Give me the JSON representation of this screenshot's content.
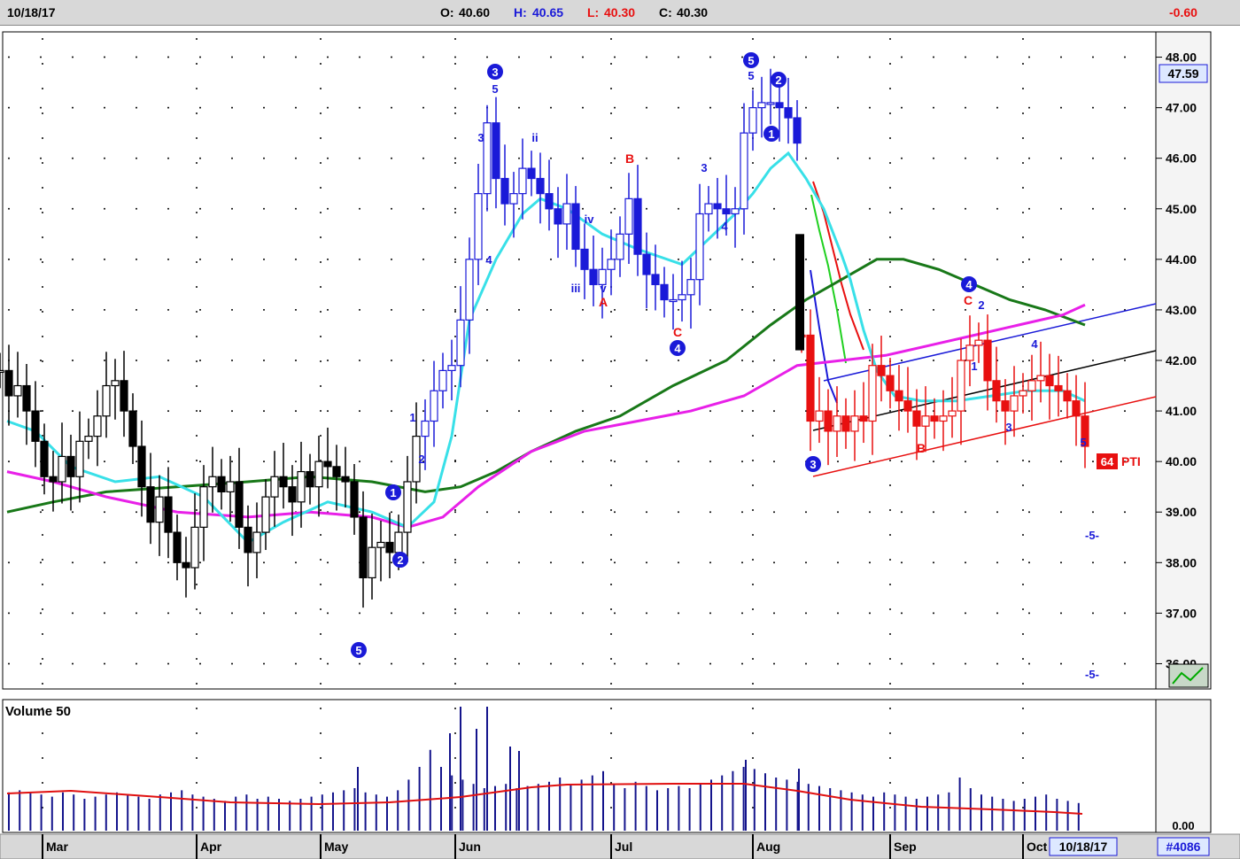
{
  "header": {
    "date": "10/18/17",
    "open_label": "O:",
    "open": "40.60",
    "high_label": "H:",
    "high": "40.65",
    "low_label": "L:",
    "low": "40.30",
    "close_label": "C:",
    "close": "40.30",
    "change": "-0.60"
  },
  "colors": {
    "bar_up_down": "#000000",
    "wave_blue": "#1a1ad8",
    "recent_red": "#e81010",
    "ema_cyan": "#38e0e8",
    "ma_magenta": "#e820e8",
    "ma_green": "#187818",
    "volume_bar": "#14148c",
    "volume_avg": "#e01010"
  },
  "price_panel": {
    "current_price": "47.59",
    "footer_badge": "#4086",
    "date_badge": "10/18/17",
    "pti_value": "64",
    "pti_label": "PTI",
    "target_markers": [
      "-5-",
      "-5-"
    ]
  },
  "volume_panel": {
    "title": "Volume 50",
    "axis_label": "0.00"
  },
  "chart_data": {
    "type": "candlestick",
    "y_axis": {
      "min": 35.5,
      "max": 48.5,
      "ticks": [
        "36.00",
        "37.00",
        "38.00",
        "39.00",
        "40.00",
        "41.00",
        "42.00",
        "43.00",
        "44.00",
        "45.00",
        "46.00",
        "47.00",
        "48.00"
      ]
    },
    "x_axis": {
      "months": [
        "Mar",
        "Apr",
        "May",
        "Jun",
        "Jul",
        "Aug",
        "Sep",
        "Oct"
      ]
    },
    "price_series": [
      [
        0,
        41.8
      ],
      [
        10,
        41.3
      ],
      [
        20,
        41.5
      ],
      [
        30,
        41.0
      ],
      [
        40,
        40.4
      ],
      [
        50,
        39.7
      ],
      [
        60,
        39.6
      ],
      [
        70,
        40.1
      ],
      [
        80,
        39.7
      ],
      [
        90,
        40.4
      ],
      [
        100,
        40.5
      ],
      [
        110,
        40.9
      ],
      [
        120,
        41.5
      ],
      [
        130,
        41.6
      ],
      [
        140,
        41.0
      ],
      [
        150,
        40.3
      ],
      [
        160,
        39.5
      ],
      [
        170,
        38.8
      ],
      [
        180,
        39.3
      ],
      [
        190,
        38.6
      ],
      [
        200,
        38.0
      ],
      [
        210,
        37.9
      ],
      [
        220,
        38.7
      ],
      [
        230,
        39.5
      ],
      [
        240,
        39.7
      ],
      [
        250,
        39.4
      ],
      [
        260,
        39.6
      ],
      [
        270,
        38.7
      ],
      [
        280,
        38.2
      ],
      [
        290,
        38.6
      ],
      [
        300,
        39.3
      ],
      [
        310,
        39.7
      ],
      [
        320,
        39.5
      ],
      [
        330,
        39.2
      ],
      [
        340,
        39.8
      ],
      [
        350,
        39.5
      ],
      [
        360,
        40.0
      ],
      [
        370,
        39.9
      ],
      [
        380,
        39.7
      ],
      [
        390,
        39.6
      ],
      [
        400,
        38.9
      ],
      [
        410,
        37.7
      ],
      [
        420,
        38.3
      ],
      [
        430,
        38.4
      ],
      [
        440,
        38.2
      ],
      [
        450,
        38.6
      ],
      [
        460,
        39.6
      ],
      [
        470,
        40.5
      ],
      [
        480,
        40.8
      ],
      [
        490,
        41.4
      ],
      [
        500,
        41.8
      ],
      [
        510,
        41.9
      ],
      [
        520,
        42.8
      ],
      [
        530,
        44.0
      ],
      [
        540,
        45.3
      ],
      [
        550,
        46.7
      ],
      [
        560,
        45.6
      ],
      [
        570,
        45.1
      ],
      [
        580,
        45.3
      ],
      [
        590,
        45.8
      ],
      [
        600,
        45.6
      ],
      [
        610,
        45.3
      ],
      [
        620,
        45.0
      ],
      [
        630,
        44.7
      ],
      [
        640,
        45.1
      ],
      [
        650,
        44.2
      ],
      [
        660,
        43.8
      ],
      [
        670,
        43.5
      ],
      [
        680,
        43.8
      ],
      [
        690,
        44.0
      ],
      [
        700,
        44.5
      ],
      [
        710,
        45.2
      ],
      [
        720,
        44.1
      ],
      [
        730,
        43.7
      ],
      [
        740,
        43.5
      ],
      [
        750,
        43.2
      ],
      [
        760,
        43.2
      ],
      [
        770,
        43.3
      ],
      [
        780,
        43.6
      ],
      [
        790,
        44.9
      ],
      [
        800,
        45.1
      ],
      [
        810,
        45.0
      ],
      [
        820,
        44.9
      ],
      [
        830,
        45.0
      ],
      [
        840,
        46.5
      ],
      [
        850,
        47.0
      ],
      [
        860,
        47.1
      ],
      [
        870,
        47.1
      ],
      [
        880,
        47.0
      ],
      [
        890,
        46.8
      ],
      [
        900,
        46.3
      ]
    ],
    "recent_series": [
      [
        905,
        42.5
      ],
      [
        915,
        40.8
      ],
      [
        925,
        41.0
      ],
      [
        935,
        40.6
      ],
      [
        945,
        40.9
      ],
      [
        955,
        40.6
      ],
      [
        965,
        40.9
      ],
      [
        975,
        40.8
      ],
      [
        985,
        41.9
      ],
      [
        995,
        41.7
      ],
      [
        1005,
        41.4
      ],
      [
        1015,
        41.2
      ],
      [
        1025,
        41.0
      ],
      [
        1035,
        40.7
      ],
      [
        1045,
        40.9
      ],
      [
        1055,
        40.8
      ],
      [
        1065,
        40.9
      ],
      [
        1075,
        41.0
      ],
      [
        1085,
        42.0
      ],
      [
        1095,
        42.3
      ],
      [
        1105,
        42.4
      ],
      [
        1115,
        41.6
      ],
      [
        1125,
        41.2
      ],
      [
        1135,
        41.0
      ],
      [
        1145,
        41.3
      ],
      [
        1155,
        41.4
      ],
      [
        1165,
        41.6
      ],
      [
        1175,
        41.7
      ],
      [
        1185,
        41.5
      ],
      [
        1195,
        41.4
      ],
      [
        1205,
        41.2
      ],
      [
        1215,
        40.9
      ],
      [
        1225,
        40.3
      ]
    ],
    "ema_fast": [
      [
        8,
        40.8
      ],
      [
        40,
        40.6
      ],
      [
        80,
        39.9
      ],
      [
        130,
        39.6
      ],
      [
        180,
        39.7
      ],
      [
        230,
        39.3
      ],
      [
        280,
        38.4
      ],
      [
        320,
        38.8
      ],
      [
        370,
        39.2
      ],
      [
        420,
        39.0
      ],
      [
        460,
        38.7
      ],
      [
        490,
        39.2
      ],
      [
        510,
        40.5
      ],
      [
        530,
        42.8
      ],
      [
        560,
        44.0
      ],
      [
        590,
        44.9
      ],
      [
        610,
        45.2
      ],
      [
        640,
        45.0
      ],
      [
        680,
        44.5
      ],
      [
        720,
        44.2
      ],
      [
        770,
        43.9
      ],
      [
        800,
        44.4
      ],
      [
        830,
        44.9
      ],
      [
        850,
        45.3
      ],
      [
        870,
        45.8
      ],
      [
        890,
        46.1
      ],
      [
        910,
        45.6
      ],
      [
        930,
        45.0
      ],
      [
        950,
        44.1
      ],
      [
        960,
        43.6
      ],
      [
        975,
        42.6
      ],
      [
        990,
        41.8
      ],
      [
        1010,
        41.3
      ],
      [
        1040,
        41.2
      ],
      [
        1080,
        41.2
      ],
      [
        1120,
        41.3
      ],
      [
        1160,
        41.4
      ],
      [
        1200,
        41.4
      ],
      [
        1225,
        41.2
      ]
    ],
    "ma_magenta": [
      [
        8,
        39.8
      ],
      [
        60,
        39.6
      ],
      [
        120,
        39.3
      ],
      [
        200,
        39.0
      ],
      [
        280,
        38.9
      ],
      [
        350,
        39.0
      ],
      [
        420,
        38.9
      ],
      [
        460,
        38.7
      ],
      [
        500,
        38.9
      ],
      [
        540,
        39.5
      ],
      [
        600,
        40.2
      ],
      [
        660,
        40.6
      ],
      [
        720,
        40.8
      ],
      [
        780,
        41.0
      ],
      [
        840,
        41.3
      ],
      [
        900,
        41.9
      ],
      [
        950,
        42.0
      ],
      [
        1000,
        42.1
      ],
      [
        1050,
        42.3
      ],
      [
        1100,
        42.5
      ],
      [
        1150,
        42.7
      ],
      [
        1200,
        42.9
      ],
      [
        1225,
        43.1
      ]
    ],
    "ma_green": [
      [
        8,
        39.0
      ],
      [
        60,
        39.2
      ],
      [
        120,
        39.4
      ],
      [
        200,
        39.5
      ],
      [
        280,
        39.6
      ],
      [
        350,
        39.7
      ],
      [
        420,
        39.6
      ],
      [
        480,
        39.4
      ],
      [
        520,
        39.5
      ],
      [
        560,
        39.8
      ],
      [
        600,
        40.2
      ],
      [
        650,
        40.6
      ],
      [
        700,
        40.9
      ],
      [
        760,
        41.5
      ],
      [
        820,
        42.0
      ],
      [
        870,
        42.7
      ],
      [
        910,
        43.2
      ],
      [
        950,
        43.6
      ],
      [
        990,
        44.0
      ],
      [
        1020,
        44.0
      ],
      [
        1060,
        43.8
      ],
      [
        1100,
        43.5
      ],
      [
        1140,
        43.2
      ],
      [
        1180,
        43.0
      ],
      [
        1225,
        42.7
      ]
    ],
    "volume_values": [
      18,
      19,
      18,
      17,
      16,
      18,
      17,
      15,
      16,
      17,
      18,
      17,
      16,
      15,
      17,
      18,
      19,
      17,
      16,
      15,
      14,
      16,
      17,
      15,
      16,
      15,
      14,
      15,
      16,
      17,
      18,
      19,
      20,
      18,
      17,
      16,
      19,
      24,
      30,
      38,
      30,
      26,
      24,
      22,
      20,
      21,
      22,
      20,
      21,
      22,
      23,
      25,
      22,
      24,
      26,
      28,
      22,
      20,
      23,
      21,
      19,
      20,
      21,
      20,
      22,
      24,
      26,
      28,
      30,
      29,
      27,
      25,
      24,
      23,
      22,
      21,
      20,
      19,
      18,
      17,
      16,
      18,
      17,
      16,
      15,
      16,
      17,
      18,
      25,
      20,
      17,
      16,
      15,
      14,
      15,
      16,
      17,
      15,
      14,
      13
    ]
  }
}
